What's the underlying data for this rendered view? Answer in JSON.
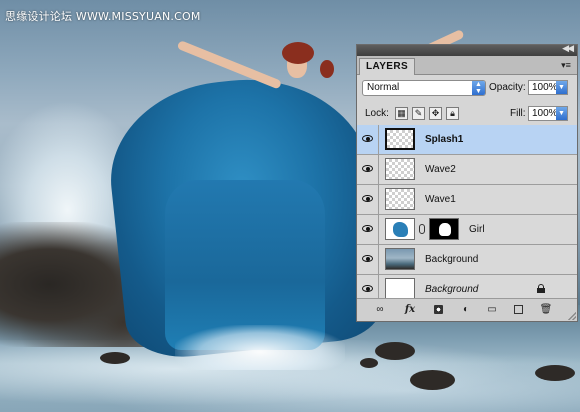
{
  "watermark": "思缘设计论坛 WWW.MISSYUAN.COM",
  "panel": {
    "tab_label": "LAYERS",
    "collapse_glyph": "◀◀",
    "menu_glyph": "▾≡",
    "blend_mode": "Normal",
    "opacity_label": "Opacity:",
    "opacity_value": "100%",
    "lock_label": "Lock:",
    "fill_label": "Fill:",
    "fill_value": "100%",
    "layers": [
      {
        "name": "Splash1",
        "thumb": "transparent",
        "selected": true,
        "visible": true
      },
      {
        "name": "Wave2",
        "thumb": "transparent",
        "selected": false,
        "visible": true
      },
      {
        "name": "Wave1",
        "thumb": "transparent",
        "selected": false,
        "visible": true
      },
      {
        "name": "Girl",
        "thumb": "girl",
        "has_mask": true,
        "selected": false,
        "visible": true
      },
      {
        "name": "Background",
        "thumb": "photo",
        "selected": false,
        "visible": true
      },
      {
        "name": "Background",
        "thumb": "white",
        "italic": true,
        "locked": true,
        "selected": false,
        "visible": true
      }
    ],
    "footer": {
      "link_glyph": "∞",
      "fx_glyph": "fx"
    },
    "colors": {
      "selected_row": "#b8d3f3",
      "dropdown_arrow": "#2f6fcf"
    }
  }
}
